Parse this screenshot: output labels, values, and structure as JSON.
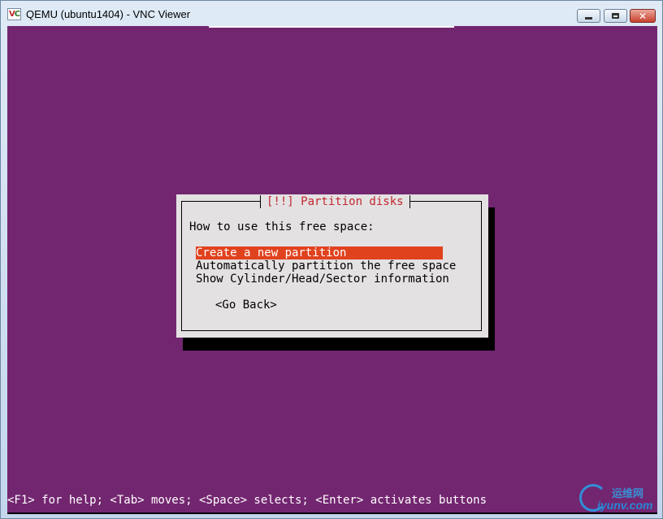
{
  "window": {
    "title": "QEMU (ubuntu1404) - VNC Viewer",
    "icon": "vnc-viewer-icon",
    "icon_text_v": "V",
    "icon_text_c": "C",
    "controls": {
      "minimize": "minimize-icon",
      "maximize": "maximize-icon",
      "close_glyph": "✕"
    }
  },
  "console": {
    "background": "#732670",
    "dialog": {
      "title": "[!!] Partition disks",
      "question": "How to use this free space:",
      "options": [
        "Create a new partition",
        "Automatically partition the free space",
        "Show Cylinder/Head/Sector information"
      ],
      "selected_index": 0,
      "back_button": "<Go Back>"
    },
    "status_line": "<F1> for help; <Tab> moves; <Space> selects; <Enter> activates buttons"
  },
  "watermark": {
    "chinese": "运维网",
    "url": "iyunv.com"
  },
  "colors": {
    "highlight": "#e0421e",
    "title_red": "#c0282d",
    "dialog_bg": "#e4e1e3"
  }
}
